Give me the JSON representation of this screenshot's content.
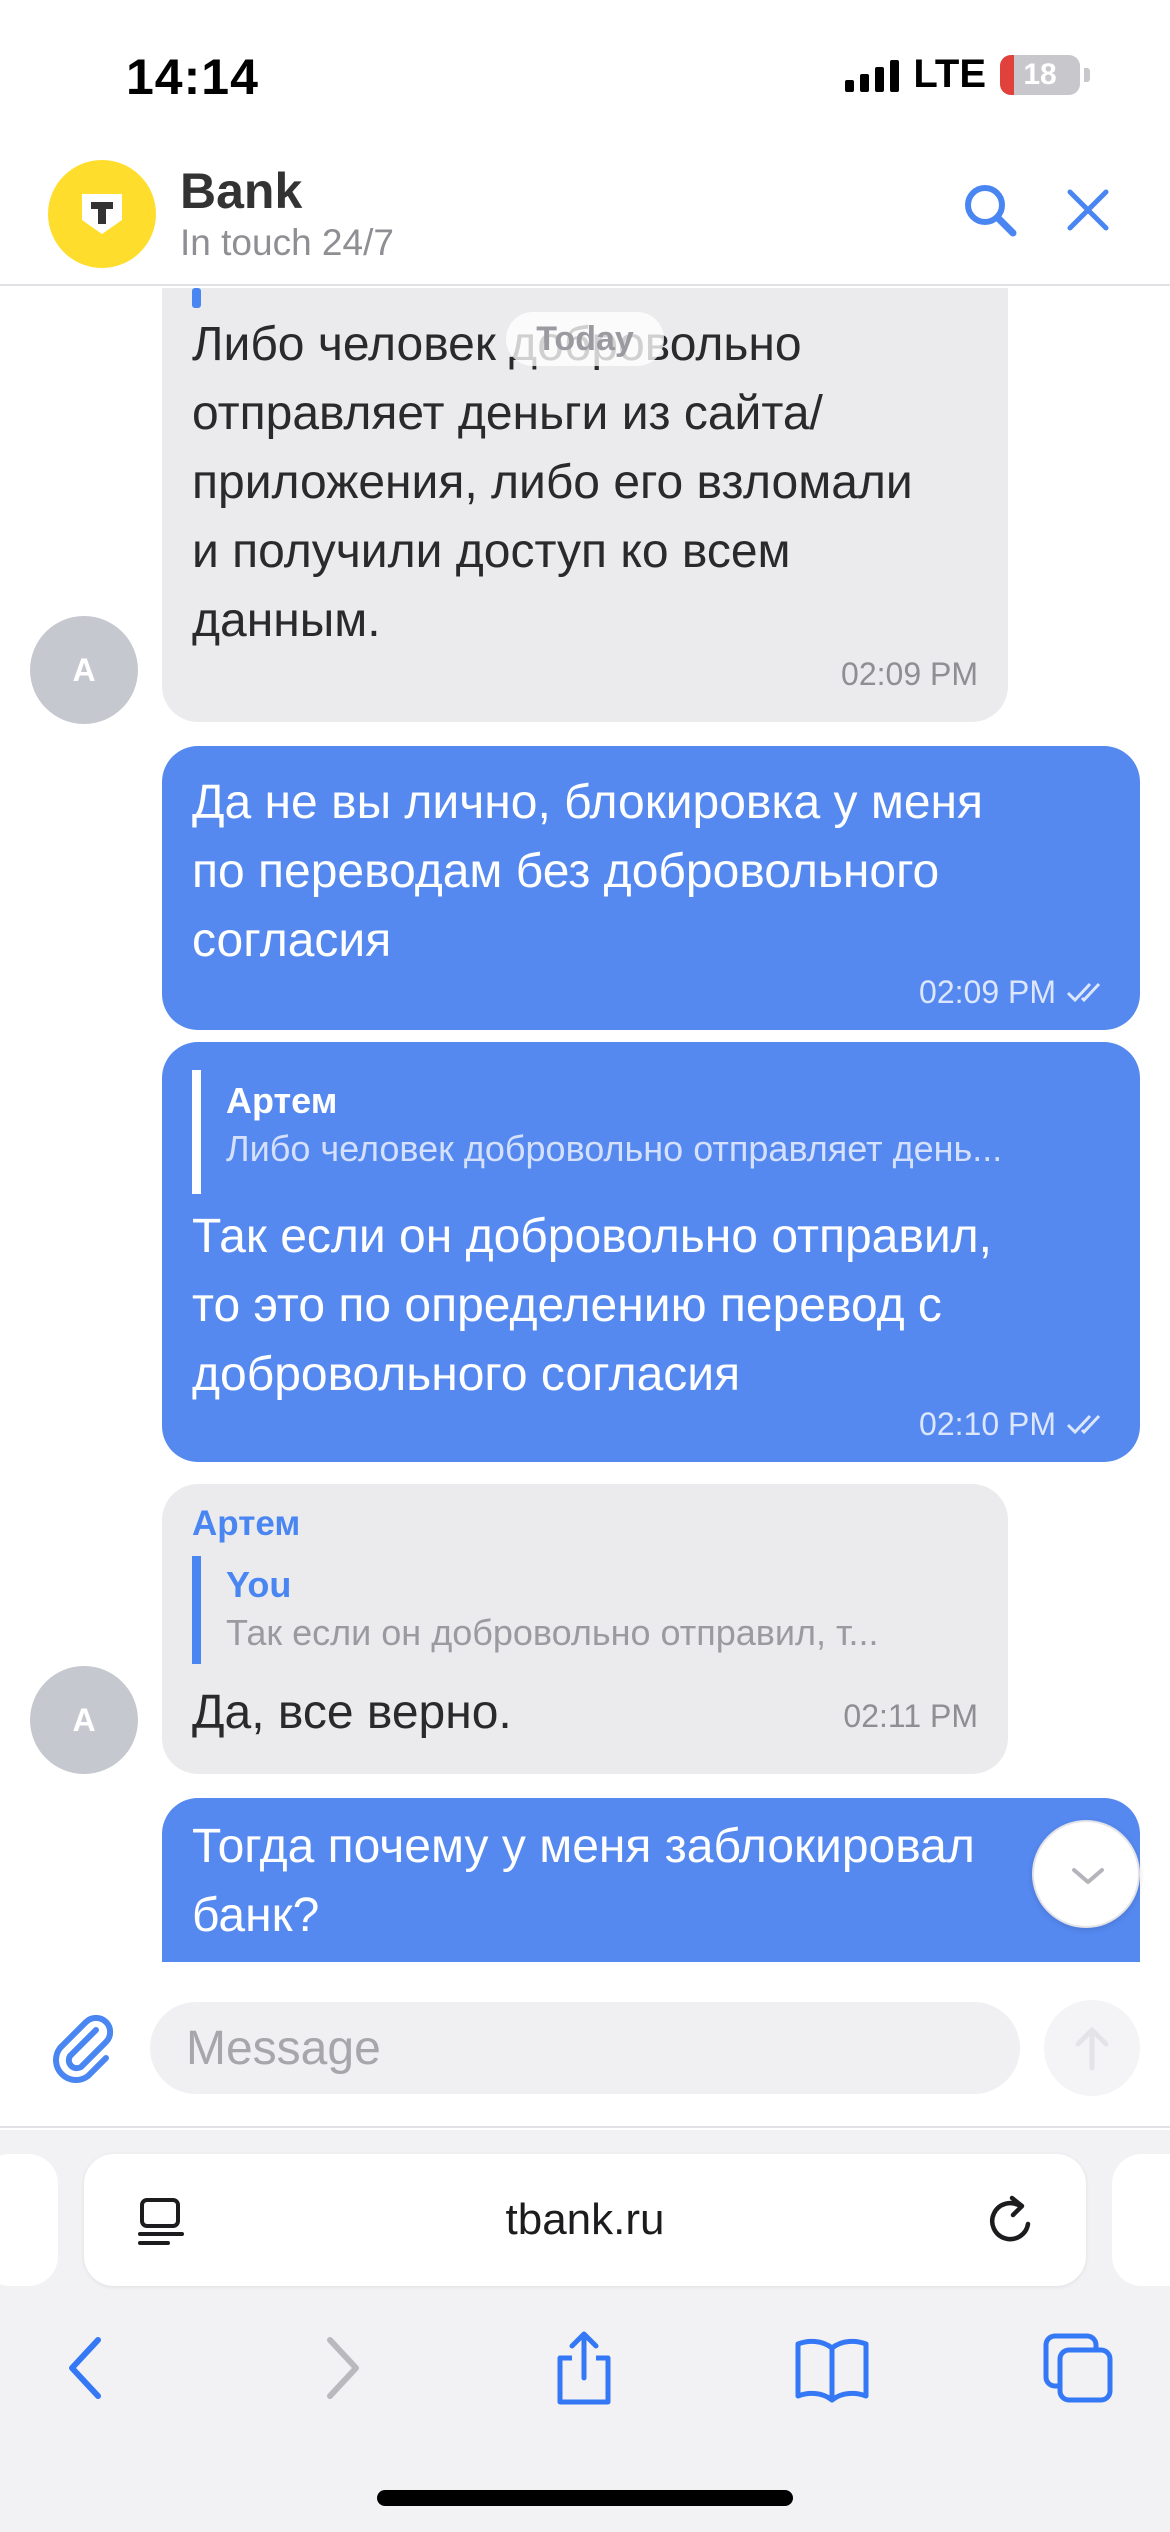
{
  "status_bar": {
    "time": "14:14",
    "network": "LTE",
    "battery_level": "18",
    "battery_fraction": 0.18,
    "battery_color": "#e0413a"
  },
  "header": {
    "title": "Bank",
    "subtitle": "In touch 24/7",
    "logo_letter": "T",
    "logo_color": "#ffdd2d",
    "search_icon": "search-icon",
    "close_icon": "close-icon"
  },
  "chat": {
    "date_separator": "Today",
    "messages": [
      {
        "direction": "in",
        "avatar": "A",
        "lines": [
          "Либо человек добровольно",
          "отправляет деньги из сайта/",
          "приложения, либо его взломали",
          "и получили доступ ко всем",
          "данным."
        ],
        "time": "02:09 PM"
      },
      {
        "direction": "out",
        "lines": [
          "Да не вы лично, блокировка у меня",
          "по переводам без добровольного",
          "согласия"
        ],
        "time": "02:09 PM",
        "status": "read"
      },
      {
        "direction": "out",
        "reply_to": {
          "author": "Артем",
          "text": "Либо человек добровольно отправляет день..."
        },
        "lines": [
          "Так если он добровольно отправил,",
          "то это по определению перевод с",
          "добровольного согласия"
        ],
        "time": "02:10 PM",
        "status": "read"
      },
      {
        "direction": "in",
        "avatar": "A",
        "sender": "Артем",
        "reply_to": {
          "author": "You",
          "text": "Так если он добровольно отправил, т..."
        },
        "lines": [
          "Да, все верно."
        ],
        "time": "02:11 PM"
      },
      {
        "direction": "out",
        "lines": [
          "Тогда почему у меня заблокировал",
          "банк?"
        ]
      }
    ]
  },
  "composer": {
    "placeholder": "Message",
    "attach_icon": "paperclip-icon",
    "send_icon": "arrow-up-icon"
  },
  "browser": {
    "url": "tbank.ru",
    "toolbar": [
      "back-icon",
      "forward-icon",
      "share-icon",
      "bookmarks-icon",
      "tabs-icon"
    ]
  },
  "colors": {
    "outgoing_bubble": "#5589f0",
    "incoming_bubble": "#ebebed",
    "accent": "#4a86f2"
  }
}
